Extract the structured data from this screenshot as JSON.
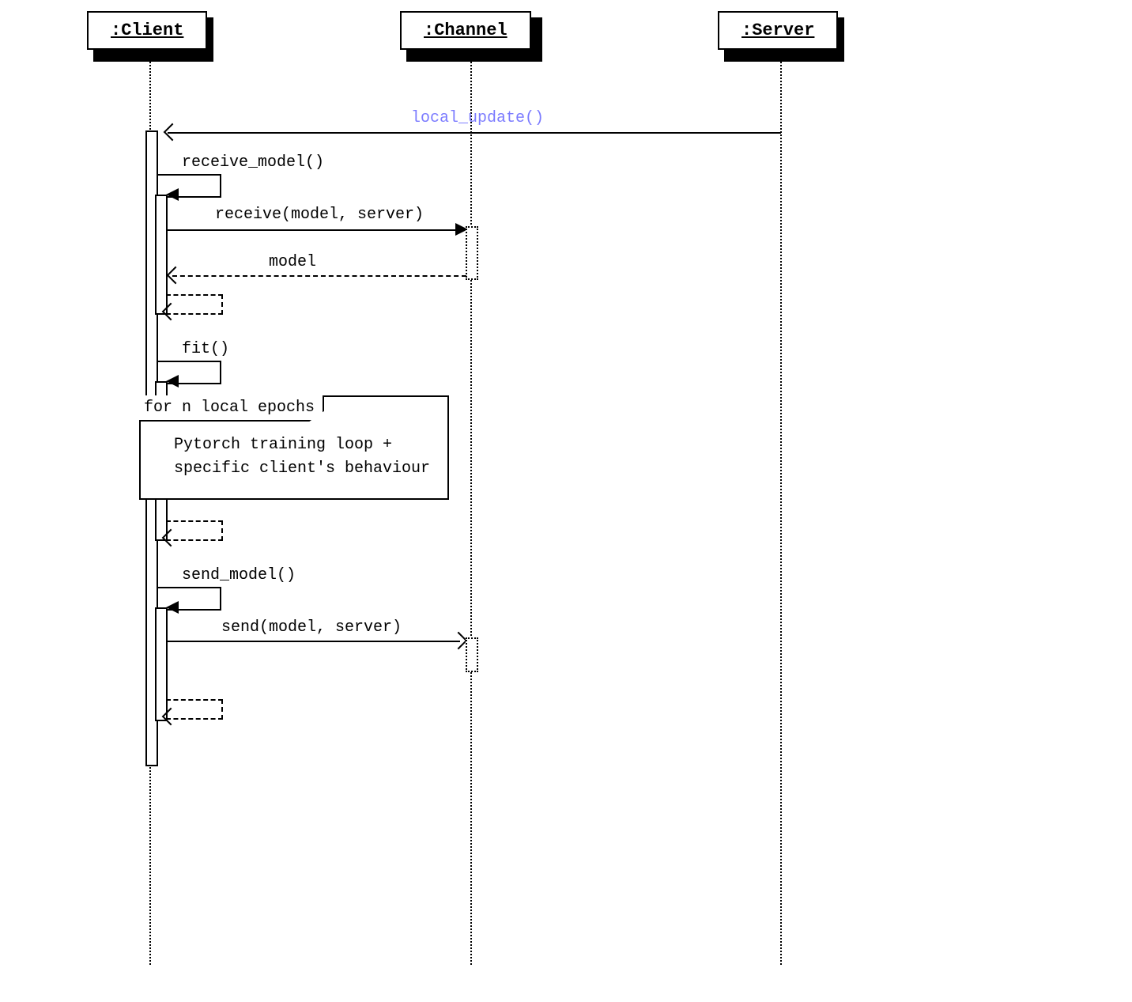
{
  "participants": {
    "client": {
      "name": ":Client"
    },
    "channel": {
      "name": ":Channel"
    },
    "server": {
      "name": ":Server"
    }
  },
  "messages": {
    "local_update": "local_update()",
    "receive_model": "receive_model()",
    "receive_cmd": "receive(model, server)",
    "model_reply": "model",
    "fit": "fit()",
    "send_model": "send_model()",
    "send_cmd": "send(model, server)"
  },
  "fragment": {
    "guard": "for n local epochs",
    "body": "Pytorch training loop +\nspecific client's behaviour"
  }
}
